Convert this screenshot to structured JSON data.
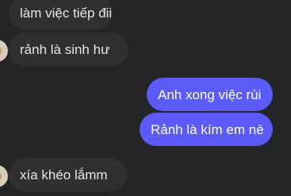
{
  "chat": {
    "messages": [
      {
        "direction": "received",
        "text": "làm việc tiếp đii"
      },
      {
        "direction": "received",
        "text": "rảnh là sinh hư"
      },
      {
        "direction": "sent",
        "text": "Anh xong việc rùi"
      },
      {
        "direction": "sent",
        "text": "Rảnh là kím em nè"
      },
      {
        "direction": "received",
        "text": "xía khéo lắmm"
      }
    ]
  },
  "colors": {
    "background": "#242526",
    "received_bubble": "#303030",
    "sent_bubble": "#5b5cf7",
    "received_text": "#e4e6eb",
    "sent_text": "#ffffff"
  }
}
